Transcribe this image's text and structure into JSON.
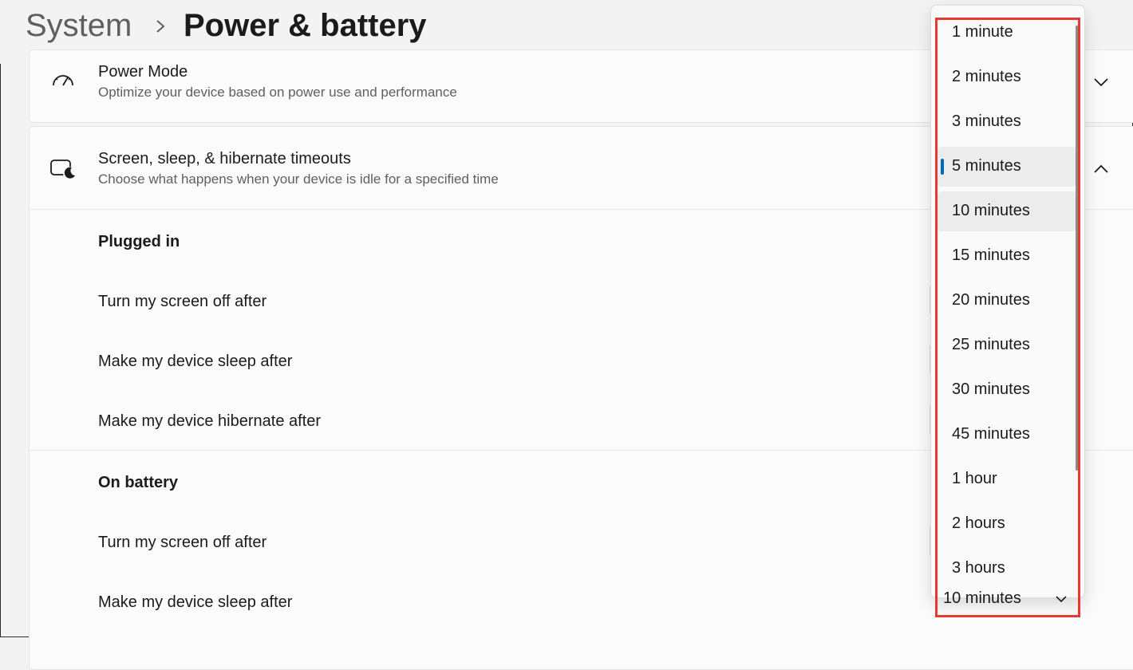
{
  "breadcrumb": {
    "parent": "System",
    "current": "Power & battery"
  },
  "power_mode": {
    "title": "Power Mode",
    "subtitle": "Optimize your device based on power use and performance",
    "icon": "speedometer-icon"
  },
  "sleep_timeouts": {
    "title": "Screen, sleep, & hibernate timeouts",
    "subtitle": "Choose what happens when your device is idle for a specified time",
    "icon": "screen-sleep-icon",
    "plugged_in": {
      "heading": "Plugged in",
      "screen_off": "Turn my screen off after",
      "sleep": "Make my device sleep after",
      "hibernate": "Make my device hibernate after"
    },
    "on_battery": {
      "heading": "On battery",
      "screen_off": "Turn my screen off after",
      "sleep": "Make my device sleep after",
      "sleep_value": "10 minutes"
    }
  },
  "flyout": {
    "options": [
      "1 minute",
      "2 minutes",
      "3 minutes",
      "5 minutes",
      "10 minutes",
      "15 minutes",
      "20 minutes",
      "25 minutes",
      "30 minutes",
      "45 minutes",
      "1 hour",
      "2 hours",
      "3 hours"
    ],
    "selected": "5 minutes",
    "hovered": "10 minutes"
  },
  "colors": {
    "accent": "#0067c0",
    "highlight_box": "#e53935"
  }
}
